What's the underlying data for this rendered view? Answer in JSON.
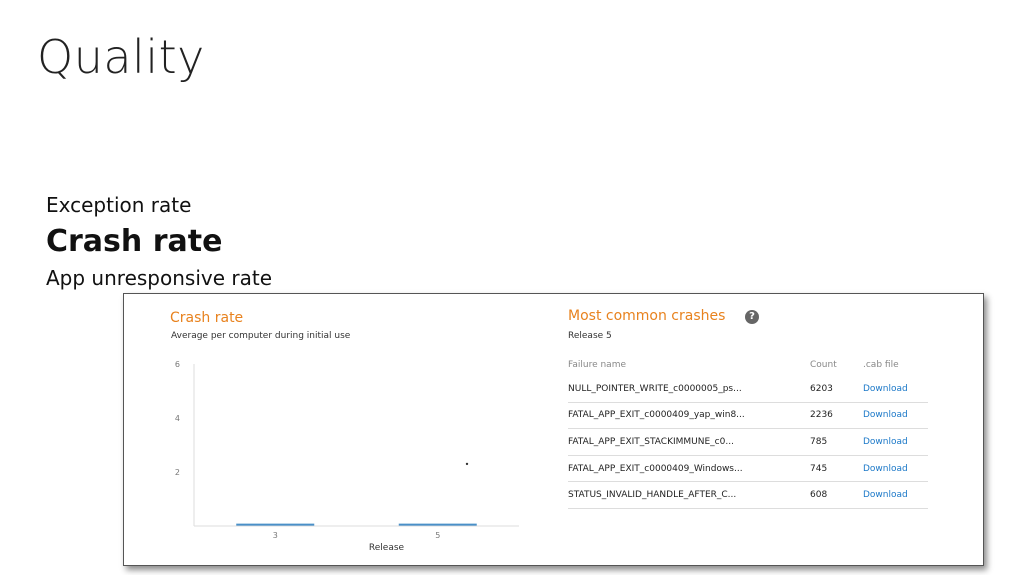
{
  "slide": {
    "title": "Quality",
    "metrics": [
      "Exception rate",
      "Crash rate",
      "App unresponsive rate"
    ]
  },
  "crash_panel": {
    "title": "Crash rate",
    "subtitle": "Average per computer during initial use"
  },
  "crashes_panel": {
    "title": "Most common crashes",
    "subtitle": "Release 5",
    "help_icon": "help-icon",
    "columns": [
      "Failure name",
      "Count",
      ".cab file"
    ],
    "rows": [
      {
        "name": "NULL_POINTER_WRITE_c0000005_ps...",
        "count": "6203",
        "cab": "Download"
      },
      {
        "name": "FATAL_APP_EXIT_c0000409_yap_win8...",
        "count": "2236",
        "cab": "Download"
      },
      {
        "name": "FATAL_APP_EXIT_STACKIMMUNE_c0...",
        "count": "785",
        "cab": "Download"
      },
      {
        "name": "FATAL_APP_EXIT_c0000409_Windows...",
        "count": "745",
        "cab": "Download"
      },
      {
        "name": "STATUS_INVALID_HANDLE_AFTER_C...",
        "count": "608",
        "cab": "Download"
      }
    ]
  },
  "colors": {
    "accent": "#e8821e",
    "link": "#1b78c8",
    "series": "#4a90c8"
  },
  "chart_data": {
    "type": "line",
    "title": "Crash rate",
    "subtitle": "Average per computer during initial use",
    "xlabel": "Release",
    "ylabel": "",
    "categories": [
      "3",
      "5"
    ],
    "values": [
      0.05,
      0.05
    ],
    "ylim": [
      0,
      6
    ],
    "yticks": [
      "2",
      "4",
      "6"
    ],
    "point": {
      "x": "5",
      "y": 2.3
    },
    "grid": false
  }
}
